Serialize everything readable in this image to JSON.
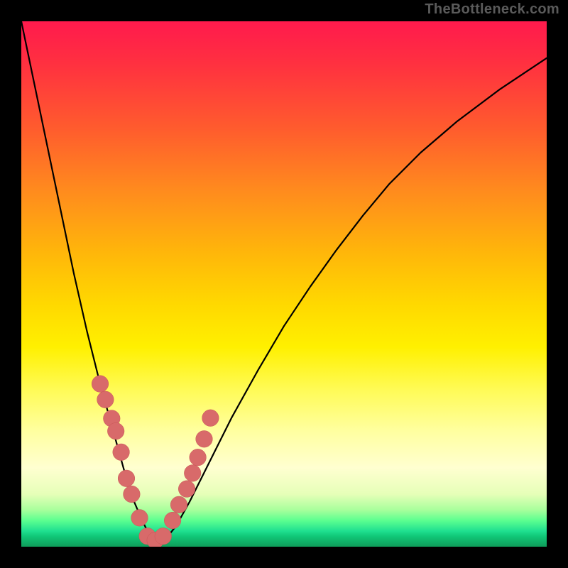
{
  "watermark": {
    "text": "TheBottleneck.com"
  },
  "colors": {
    "dot_fill": "#d86a6a",
    "dot_stroke": "#c85656",
    "curve_stroke": "#000000",
    "frame": "#000000"
  },
  "chart_data": {
    "type": "line",
    "title": "",
    "xlabel": "",
    "ylabel": "",
    "xlim": [
      0,
      1
    ],
    "ylim": [
      0,
      1
    ],
    "note": "No axes or numeric tick labels are visible; x and y are normalized 0–1. y≈1 at top (red), y≈0 at bottom (green). Curve is a V-shape with minimum near x≈0.25.",
    "series": [
      {
        "name": "curve",
        "x": [
          0.0,
          0.025,
          0.05,
          0.075,
          0.1,
          0.125,
          0.15,
          0.175,
          0.2,
          0.215,
          0.23,
          0.245,
          0.26,
          0.275,
          0.295,
          0.32,
          0.35,
          0.4,
          0.45,
          0.5,
          0.55,
          0.6,
          0.65,
          0.7,
          0.76,
          0.83,
          0.91,
          1.0
        ],
        "y": [
          1.0,
          0.88,
          0.76,
          0.64,
          0.52,
          0.41,
          0.31,
          0.22,
          0.13,
          0.085,
          0.05,
          0.02,
          0.01,
          0.015,
          0.04,
          0.085,
          0.145,
          0.245,
          0.335,
          0.42,
          0.495,
          0.565,
          0.63,
          0.69,
          0.75,
          0.81,
          0.87,
          0.93
        ]
      }
    ],
    "dots": {
      "name": "salmon-dots",
      "x": [
        0.15,
        0.16,
        0.172,
        0.18,
        0.19,
        0.2,
        0.21,
        0.225,
        0.24,
        0.255,
        0.27,
        0.288,
        0.3,
        0.315,
        0.326,
        0.336,
        0.348,
        0.36
      ],
      "y": [
        0.31,
        0.28,
        0.244,
        0.22,
        0.18,
        0.13,
        0.1,
        0.055,
        0.02,
        0.012,
        0.02,
        0.05,
        0.08,
        0.11,
        0.14,
        0.17,
        0.205,
        0.245
      ],
      "r_norm": 0.016
    }
  }
}
